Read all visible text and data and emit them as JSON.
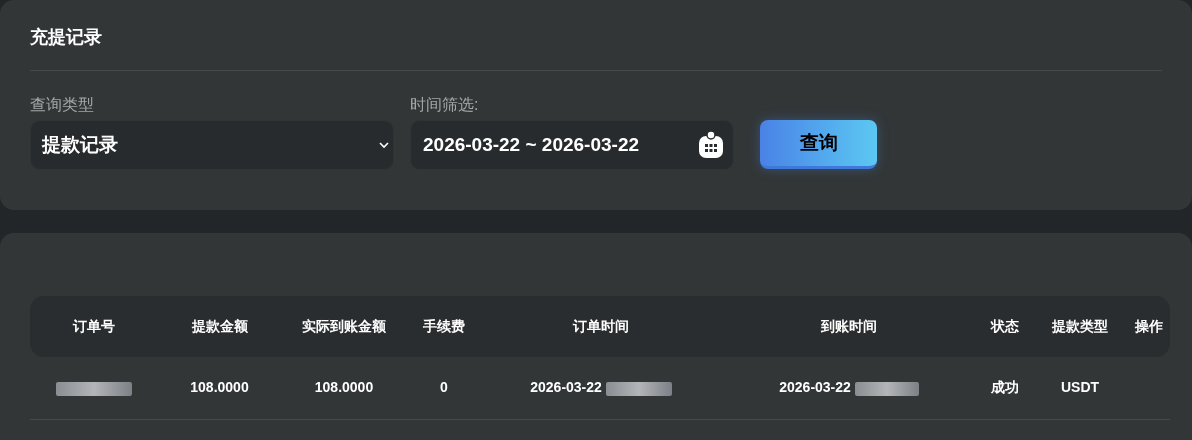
{
  "filter_card": {
    "title": "充提记录",
    "type_label": "查询类型",
    "type_value": "提款记录",
    "time_label": "时间筛选:",
    "date_range": "2026-03-22 ~ 2026-03-22",
    "query_button": "查询"
  },
  "table": {
    "columns": [
      "订单号",
      "提款金额",
      "实际到账金额",
      "手续费",
      "订单时间",
      "到账时间",
      "状态",
      "提款类型",
      "操作"
    ],
    "rows": [
      {
        "amount": "108.0000",
        "received": "108.0000",
        "fee": "0",
        "order_time": "2026-03-22",
        "arrival_time": "2026-03-22",
        "status": "成功",
        "type": "USDT"
      }
    ]
  }
}
